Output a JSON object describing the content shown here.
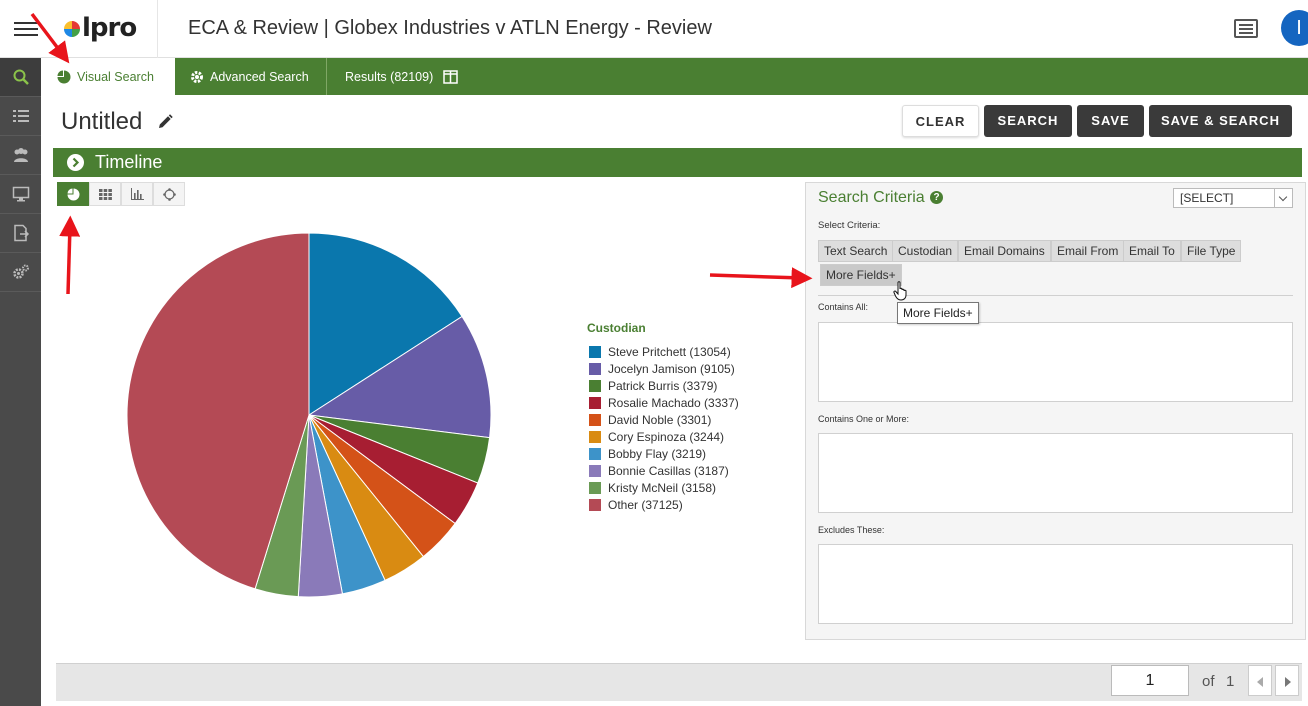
{
  "header": {
    "logo_text": "lpro",
    "title": "ECA & Review | Globex Industries v ATLN Energy - Review",
    "avatar_initial": "I"
  },
  "tabs": {
    "visual_search": "Visual Search",
    "advanced_search": "Advanced Search",
    "results": "Results (82109)"
  },
  "search": {
    "title": "Untitled",
    "clear_label": "CLEAR",
    "search_label": "SEARCH",
    "save_label": "SAVE",
    "save_search_label": "SAVE & SEARCH"
  },
  "timeline": {
    "label": "Timeline"
  },
  "criteria": {
    "title": "Search Criteria",
    "help": "?",
    "select_value": "[SELECT]",
    "select_label": "Select Criteria:",
    "chips": [
      "Text Search",
      "Custodian",
      "Email Domains",
      "Email From",
      "Email To",
      "File Type",
      "More Fields+"
    ],
    "contains_all_label": "Contains All:",
    "contains_one_label": "Contains One or More:",
    "excludes_label": "Excludes These:",
    "tooltip": "More Fields+"
  },
  "pager": {
    "current": "1",
    "of_label": "of",
    "total": "1"
  },
  "colors": {
    "brand_green": "#4a7f32",
    "dark_button": "#3a3a3a"
  },
  "chart_data": {
    "type": "pie",
    "legend_title": "Custodian",
    "categories": [
      "Steve Pritchett",
      "Jocelyn Jamison",
      "Patrick Burris",
      "Rosalie Machado",
      "David Noble",
      "Cory Espinoza",
      "Bobby Flay",
      "Bonnie Casillas",
      "Kristy McNeil",
      "Other"
    ],
    "values": [
      13054,
      9105,
      3379,
      3337,
      3301,
      3244,
      3219,
      3187,
      3158,
      37125
    ],
    "legend_labels": [
      "Steve Pritchett (13054)",
      "Jocelyn Jamison (9105)",
      "Patrick Burris (3379)",
      "Rosalie Machado (3337)",
      "David Noble (3301)",
      "Cory Espinoza (3244)",
      "Bobby Flay (3219)",
      "Bonnie Casillas (3187)",
      "Kristy McNeil (3158)",
      "Other (37125)"
    ],
    "colors": [
      "#0a77ad",
      "#675ca7",
      "#4a7f32",
      "#a71e32",
      "#d45218",
      "#d98b12",
      "#3d93c9",
      "#8a7ab9",
      "#6a9a55",
      "#b44a55"
    ],
    "legend_placement": "right"
  }
}
